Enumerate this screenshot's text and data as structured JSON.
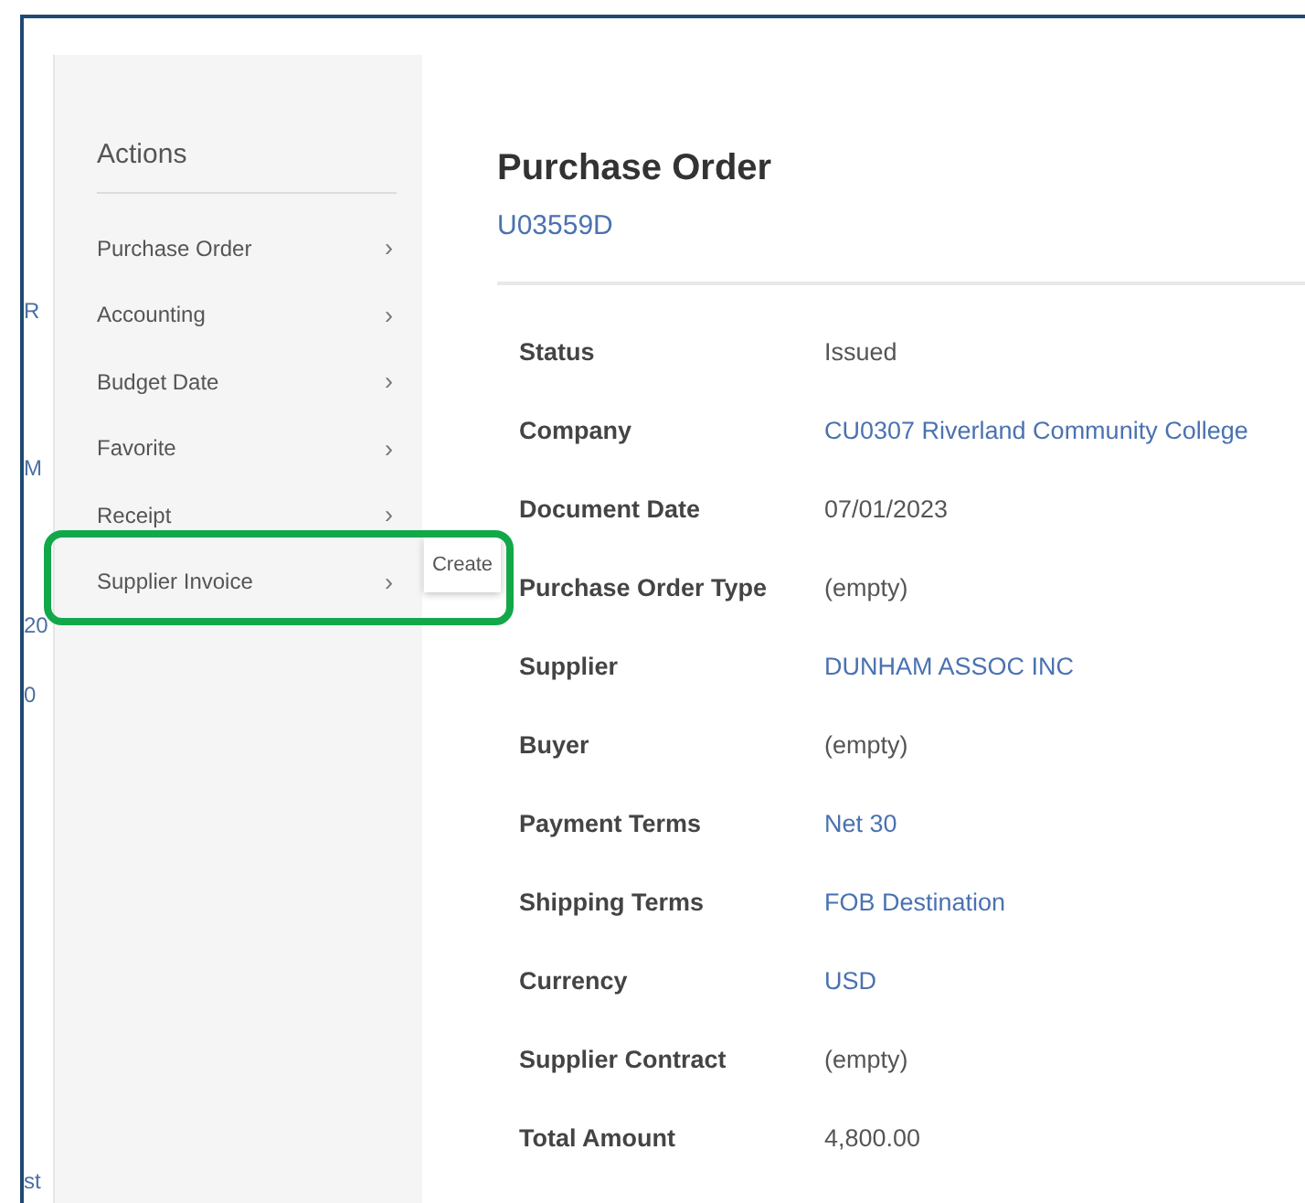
{
  "background_fragments": [
    "R",
    "M",
    "20",
    "0",
    "st"
  ],
  "actions_menu": {
    "title": "Actions",
    "items": [
      {
        "label": "Purchase Order",
        "chevron": "›"
      },
      {
        "label": "Accounting",
        "chevron": "›"
      },
      {
        "label": "Budget Date",
        "chevron": "›"
      },
      {
        "label": "Favorite",
        "chevron": "›"
      },
      {
        "label": "Receipt",
        "chevron": "›"
      },
      {
        "label": "Supplier Invoice",
        "chevron": "›"
      }
    ]
  },
  "submenu": {
    "items": [
      "Create"
    ]
  },
  "highlight": {
    "color": "#12a84a"
  },
  "record": {
    "title": "Purchase Order",
    "id": "U03559D",
    "fields": [
      {
        "label": "Status",
        "value": "Issued",
        "link": false
      },
      {
        "label": "Company",
        "value": "CU0307 Riverland Community College",
        "link": true
      },
      {
        "label": "Document Date",
        "value": "07/01/2023",
        "link": false
      },
      {
        "label": "Purchase Order Type",
        "value": "(empty)",
        "link": false
      },
      {
        "label": "Supplier",
        "value": "DUNHAM ASSOC INC",
        "link": true
      },
      {
        "label": "Buyer",
        "value": "(empty)",
        "link": false
      },
      {
        "label": "Payment Terms",
        "value": "Net 30",
        "link": true
      },
      {
        "label": "Shipping Terms",
        "value": "FOB Destination",
        "link": true
      },
      {
        "label": "Currency",
        "value": "USD",
        "link": true
      },
      {
        "label": "Supplier Contract",
        "value": "(empty)",
        "link": false
      },
      {
        "label": "Total Amount",
        "value": "4,800.00",
        "link": false
      }
    ]
  }
}
